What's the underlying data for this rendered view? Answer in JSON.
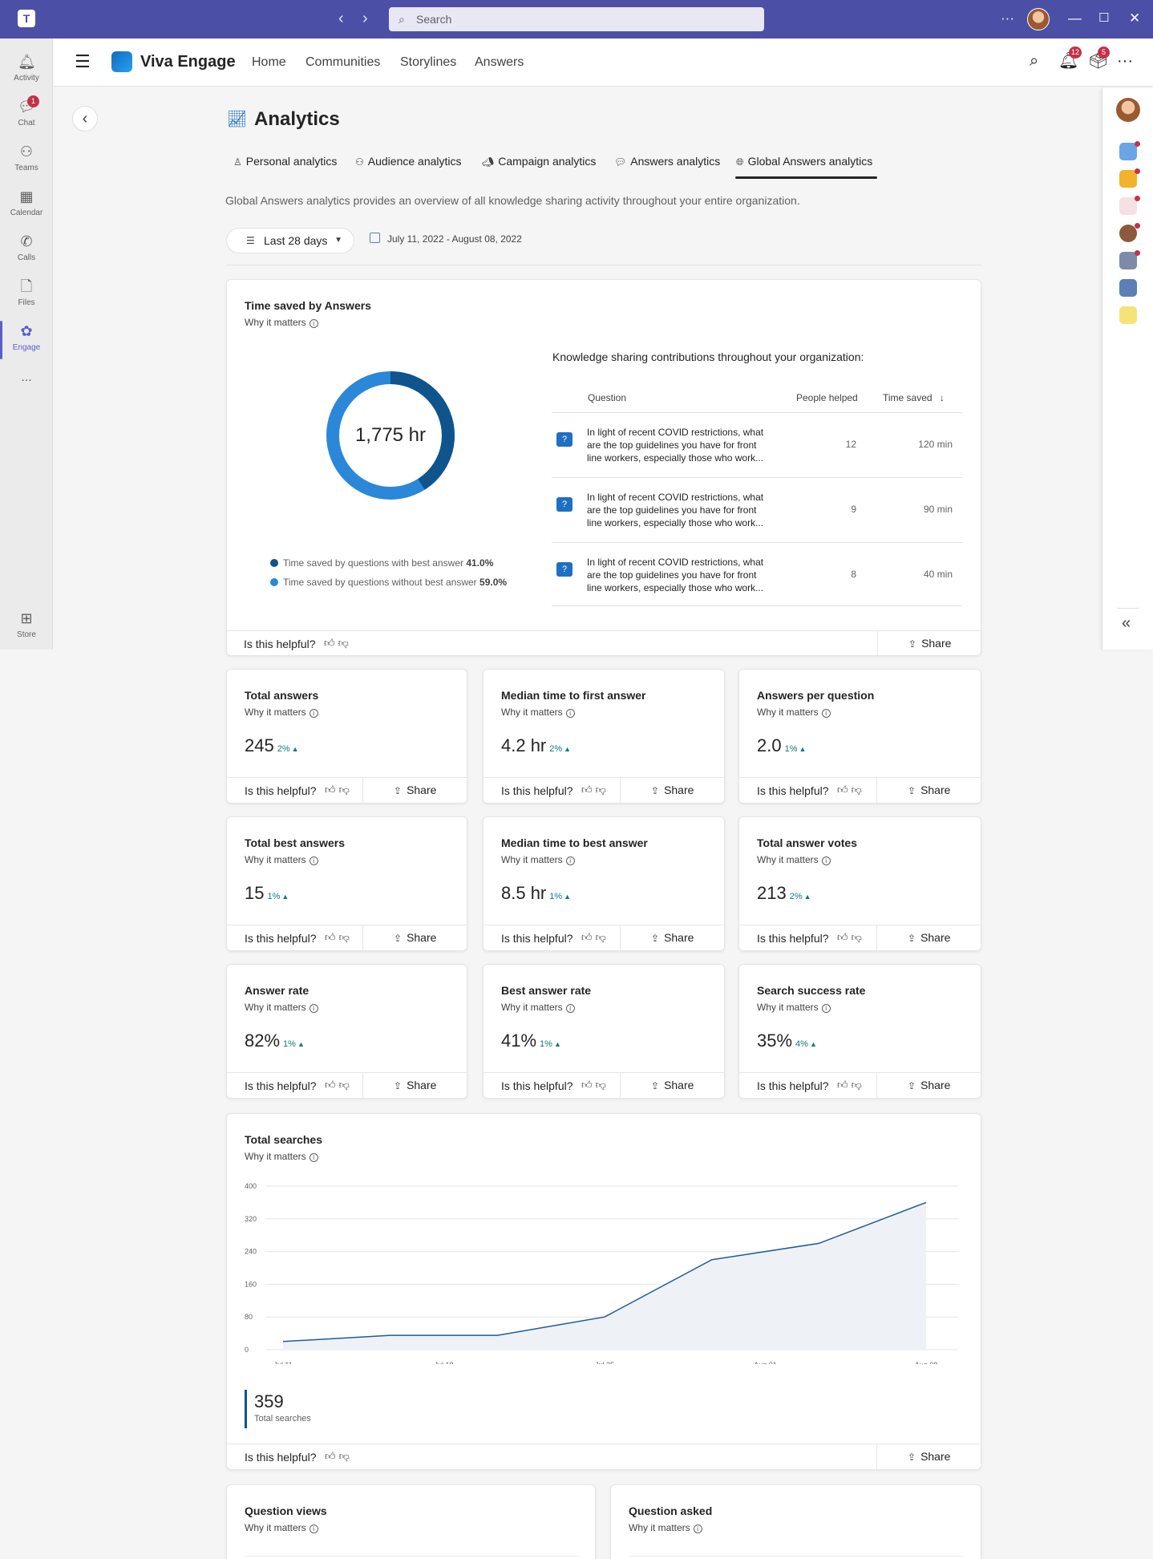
{
  "titlebar": {
    "search_placeholder": "Search"
  },
  "rail": {
    "items": [
      {
        "label": "Activity"
      },
      {
        "label": "Chat",
        "badge": "1"
      },
      {
        "label": "Teams"
      },
      {
        "label": "Calendar"
      },
      {
        "label": "Calls"
      },
      {
        "label": "Files"
      },
      {
        "label": "Engage"
      },
      {
        "label": "..."
      },
      {
        "label": "Store"
      }
    ]
  },
  "appbar": {
    "brand": "Viva Engage",
    "links": [
      "Home",
      "Communities",
      "Storylines",
      "Answers"
    ],
    "notifications_badge": "12",
    "inbox_badge": "5"
  },
  "page": {
    "title": "Analytics",
    "tabs": [
      "Personal analytics",
      "Audience analytics",
      "Campaign analytics",
      "Answers analytics",
      "Global Answers analytics"
    ],
    "active_tab": "Global Answers analytics",
    "description": "Global Answers analytics provides an overview of all knowledge sharing activity throughout your entire organization.",
    "range_label": "Last 28 days",
    "date_range": "July 11, 2022 - August 08, 2022"
  },
  "common": {
    "why_it_matters": "Why it matters",
    "helpful": "Is this helpful?",
    "share": "Share"
  },
  "time_saved": {
    "title": "Time saved by Answers",
    "total": "1,775 hr",
    "with_best_pct": 41.0,
    "without_best_pct": 59.0,
    "legend": [
      {
        "label": "Time saved by questions with best answer",
        "value": "41.0%",
        "color": "#0f548c"
      },
      {
        "label": "Time saved by questions without best answer",
        "value": "59.0%",
        "color": "#2b88d8"
      }
    ],
    "table_heading": "Knowledge sharing contributions throughout your organization:",
    "columns": [
      "Question",
      "People helped",
      "Time saved"
    ],
    "rows": [
      {
        "question": "In light of recent COVID restrictions, what are the top guidelines you have for front line workers, especially those who work...",
        "people": "12",
        "time": "120 min"
      },
      {
        "question": "In light of recent COVID restrictions, what are the top guidelines you have for front line workers, especially those who work...",
        "people": "9",
        "time": "90 min"
      },
      {
        "question": "In light of recent COVID restrictions, what are the top guidelines you have for front line workers, especially those who work...",
        "people": "8",
        "time": "40 min"
      }
    ]
  },
  "metrics": [
    {
      "title": "Total answers",
      "value": "245",
      "change": "2%"
    },
    {
      "title": "Median time to first answer",
      "value": "4.2 hr",
      "change": "2%"
    },
    {
      "title": "Answers per question",
      "value": "2.0",
      "change": "1%"
    },
    {
      "title": "Total best answers",
      "value": "15",
      "change": "1%"
    },
    {
      "title": "Median time to best answer",
      "value": "8.5 hr",
      "change": "1%"
    },
    {
      "title": "Total answer votes",
      "value": "213",
      "change": "2%"
    },
    {
      "title": "Answer rate",
      "value": "82%",
      "change": "1%"
    },
    {
      "title": "Best answer rate",
      "value": "41%",
      "change": "1%"
    },
    {
      "title": "Search success rate",
      "value": "35%",
      "change": "4%"
    }
  ],
  "total_searches": {
    "title": "Total searches",
    "stat": "359",
    "stat_label": "Total searches"
  },
  "chart_data": {
    "type": "area",
    "x": [
      "Jul 11",
      "Jul 14",
      "Jul 18",
      "Jul 22",
      "Jul 25",
      "Jul 29",
      "Aug 01",
      "Aug 05",
      "Aug 08"
    ],
    "series": [
      {
        "values": [
          20,
          35,
          35,
          80,
          220,
          260,
          360
        ]
      }
    ],
    "x_points": [
      0,
      1,
      2,
      3,
      4,
      5,
      6
    ],
    "tick_labels_x": [
      "Jul 11",
      "Jul 18",
      "Jul 25",
      "Aug 01",
      "Aug 08"
    ],
    "yticks": [
      0,
      80,
      160,
      240,
      320,
      400
    ],
    "ylim": [
      0,
      400
    ],
    "grid": true,
    "color": "#1f5c99"
  },
  "bottom_cards": [
    {
      "title": "Question views"
    },
    {
      "title": "Question asked"
    }
  ]
}
